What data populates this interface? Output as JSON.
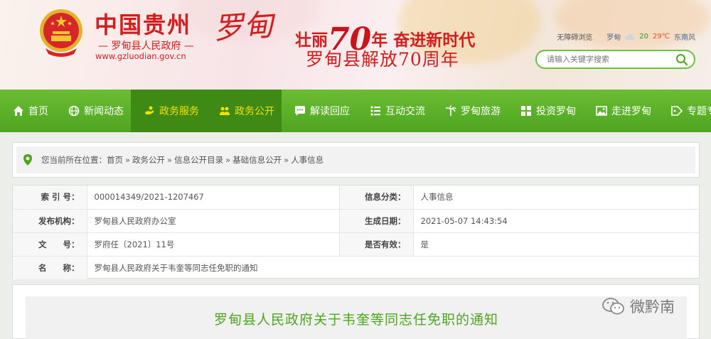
{
  "header": {
    "brand_main": "中国贵州",
    "brand_sub": "— 罗甸县人民政府 —",
    "brand_url": "www.gzluodian.gov.cn",
    "calligraphy": "罗甸",
    "slogan_prefix": "壮丽",
    "slogan_num": "70",
    "slogan_suffix": "年 奋进新时代",
    "slogan2": "罗甸县解放70周年"
  },
  "topbar": {
    "accessibility": "无障碍浏览",
    "city": "罗甸",
    "temp_low": "20",
    "temp_high": "29℃",
    "wind": "东南风"
  },
  "search": {
    "placeholder": "请输入关键字搜索"
  },
  "nav": {
    "items": [
      {
        "label": "首页",
        "icon": "home-icon"
      },
      {
        "label": "新闻动态",
        "icon": "globe-icon"
      },
      {
        "label": "政务服务",
        "icon": "hand-icon"
      },
      {
        "label": "政务公开",
        "icon": "people-icon"
      },
      {
        "label": "解读回应",
        "icon": "chat-icon"
      },
      {
        "label": "互动交流",
        "icon": "list-icon"
      },
      {
        "label": "罗甸旅游",
        "icon": "palm-icon"
      },
      {
        "label": "投资罗甸",
        "icon": "grid-icon"
      },
      {
        "label": "走进罗甸",
        "icon": "picture-icon"
      },
      {
        "label": "专题专栏",
        "icon": "tag-icon"
      }
    ],
    "active_color": "#f6e000"
  },
  "breadcrumb": {
    "prefix": "您当前所在位置：",
    "items": [
      "首页",
      "政务公开",
      "信息公开目录",
      "基础信息公开",
      "人事信息"
    ],
    "separator": "»"
  },
  "info": {
    "index_label": "索 引 号：",
    "index_value": "000014349/2021-1207467",
    "category_label": "信息分类：",
    "category_value": "人事信息",
    "publisher_label": "发布机构：",
    "publisher_value": "罗甸县人民政府办公室",
    "date_label": "生成日期：",
    "date_value": "2021-05-07 14:43:54",
    "docno_label": "文　　号：",
    "docno_value": "罗府任〔2021〕11号",
    "valid_label": "是否有效：",
    "valid_value": "是",
    "name_label": "名　　称：",
    "name_value": "罗甸县人民政府关于韦奎等同志任免职的通知"
  },
  "article": {
    "title": "罗甸县人民政府关于韦奎等同志任免职的通知"
  },
  "watermark": {
    "text": "微黔南"
  },
  "colors": {
    "nav_green": "#5cb12a",
    "brand_red": "#d21e1e",
    "title_green": "#4ea520"
  }
}
